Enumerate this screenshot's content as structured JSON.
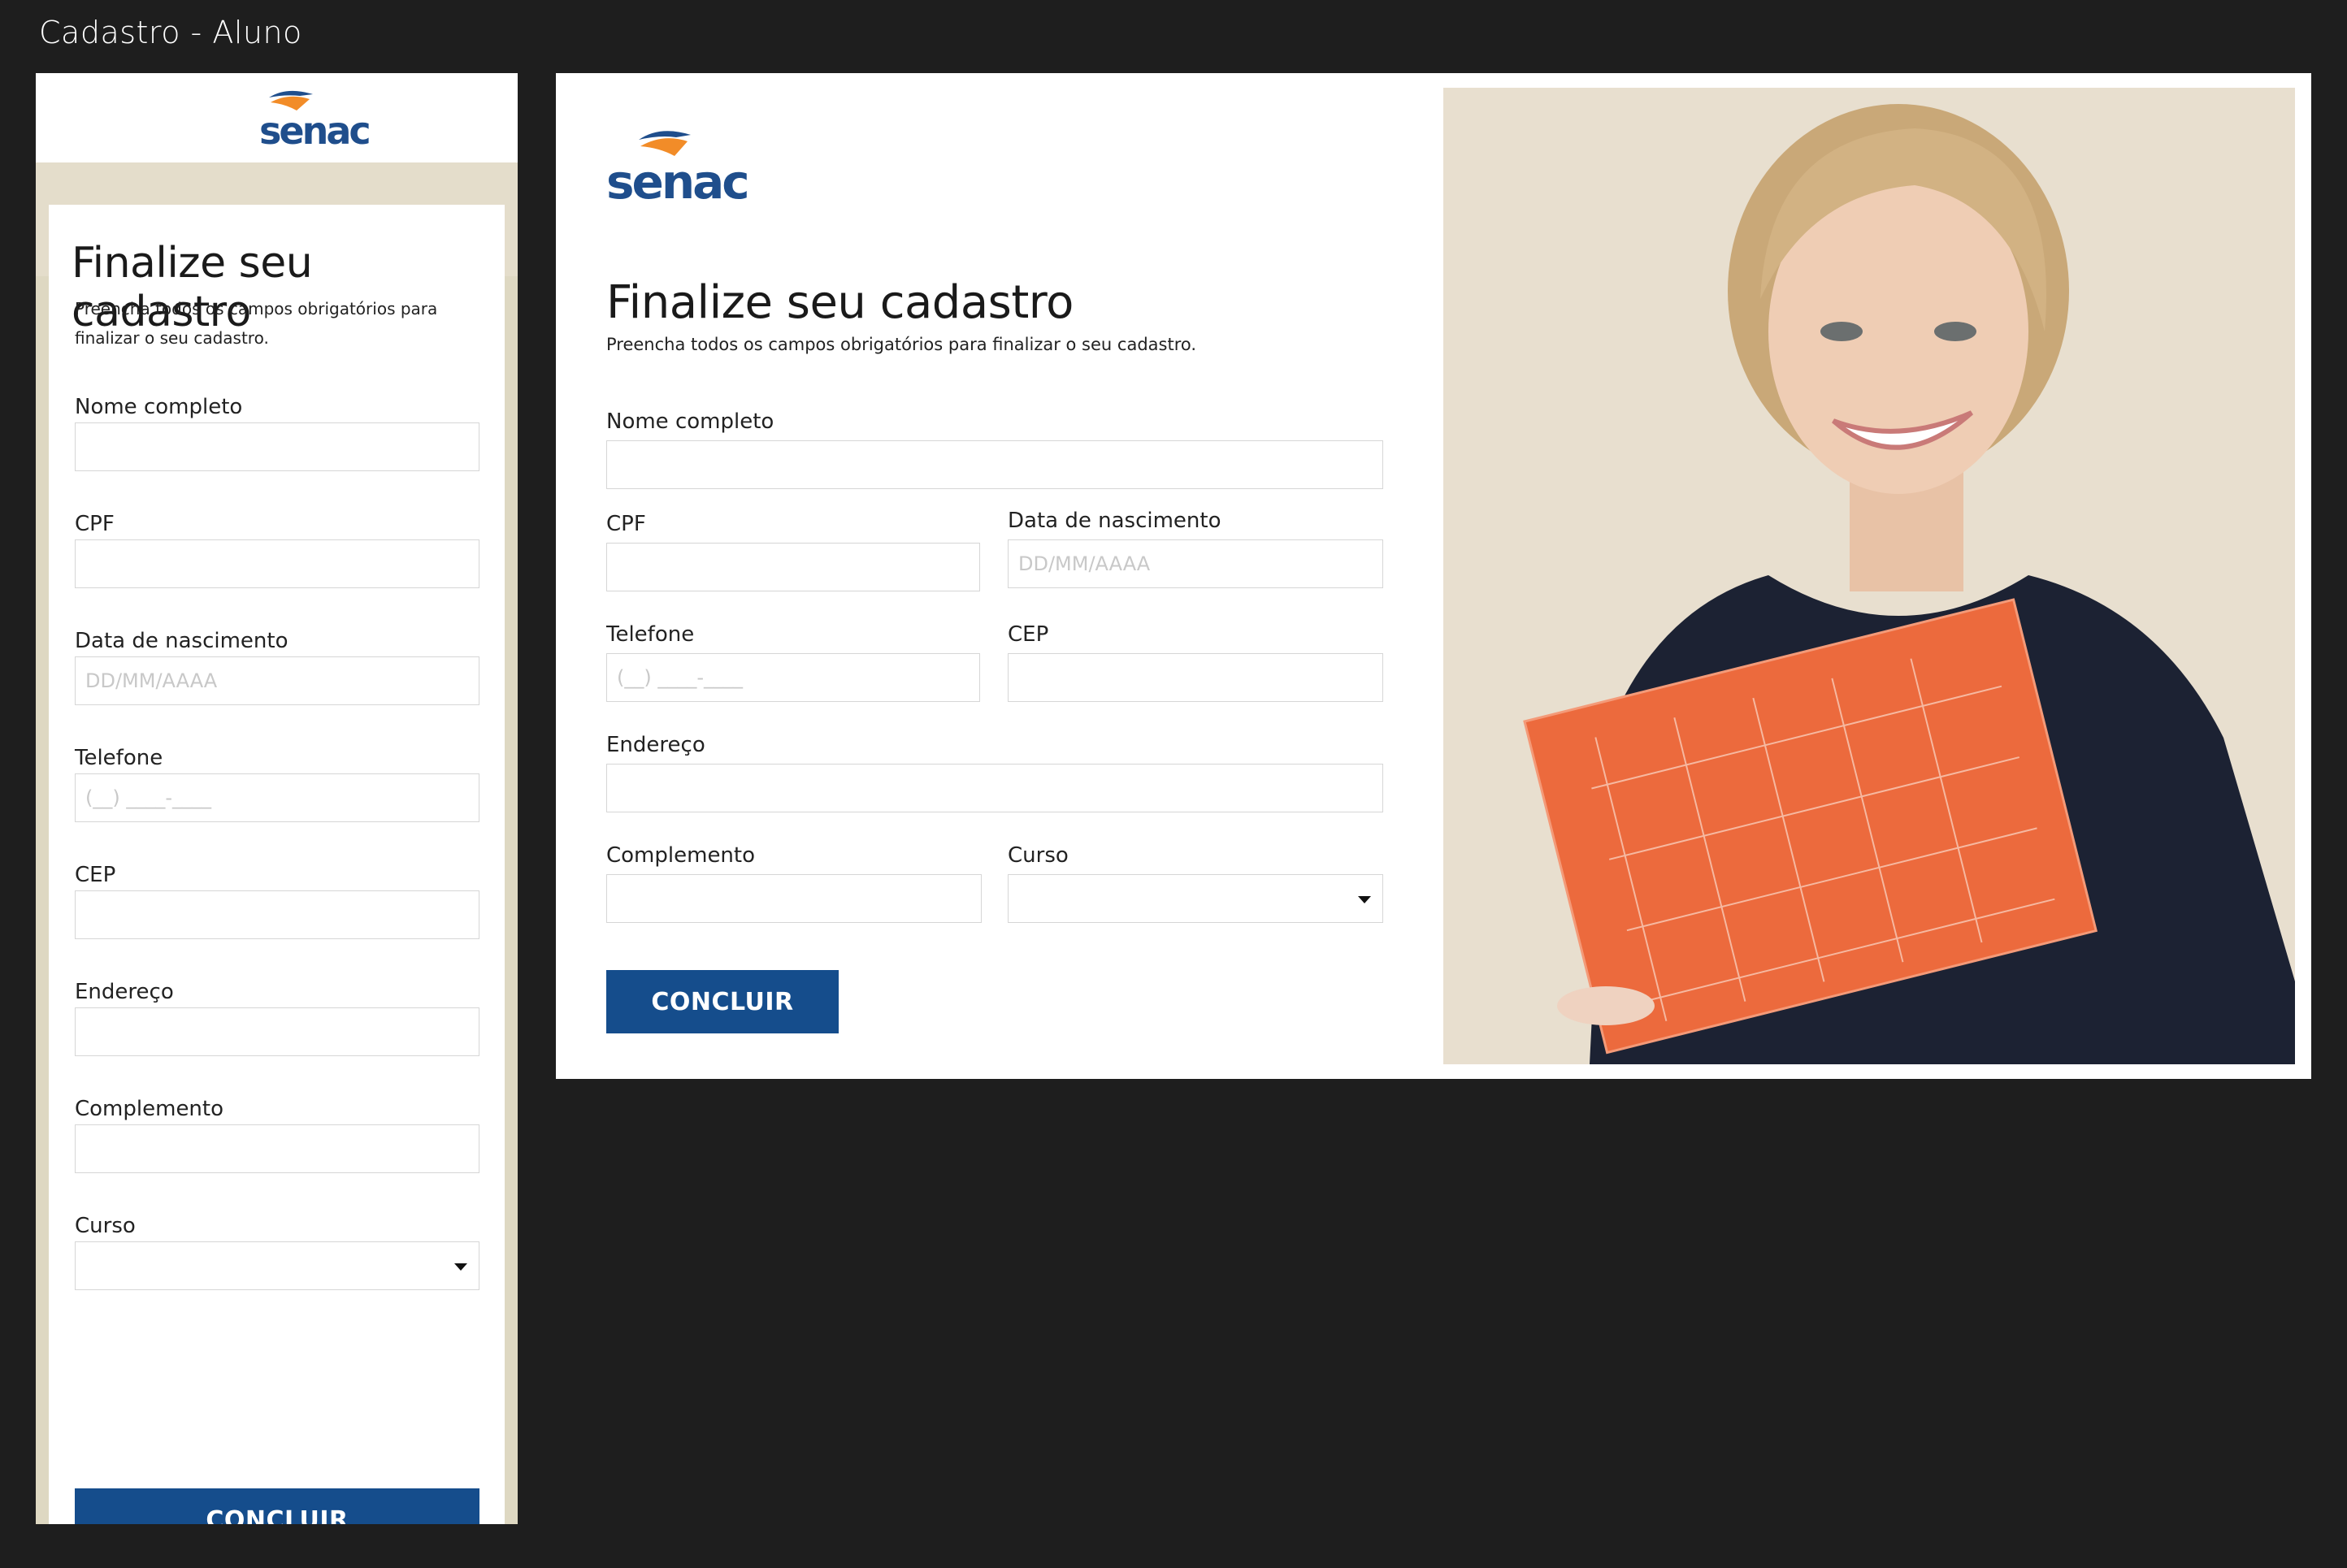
{
  "window": {
    "title": "Cadastro - Aluno"
  },
  "brand": {
    "logo_text": "senac",
    "primary_color": "#154d8c",
    "accent_color": "#f28c28"
  },
  "form": {
    "title": "Finalize seu cadastro",
    "subtitle": "Preencha todos os campos obrigatórios para finalizar o seu cadastro.",
    "fields": {
      "nome": {
        "label": "Nome completo",
        "value": "",
        "placeholder": ""
      },
      "cpf": {
        "label": "CPF",
        "value": "",
        "placeholder": ""
      },
      "nascimento": {
        "label": "Data de nascimento",
        "value": "",
        "placeholder": "DD/MM/AAAA"
      },
      "telefone": {
        "label": "Telefone",
        "value": "",
        "placeholder": "(__) ____-____"
      },
      "cep": {
        "label": "CEP",
        "value": "",
        "placeholder": ""
      },
      "endereco": {
        "label": "Endereço",
        "value": "",
        "placeholder": ""
      },
      "complemento": {
        "label": "Complemento",
        "value": "",
        "placeholder": ""
      },
      "curso": {
        "label": "Curso",
        "selected": ""
      }
    },
    "submit_label": "CONCLUIR"
  },
  "icons": {
    "logo": "senac-logo-icon",
    "dropdown": "chevron-down-icon"
  }
}
